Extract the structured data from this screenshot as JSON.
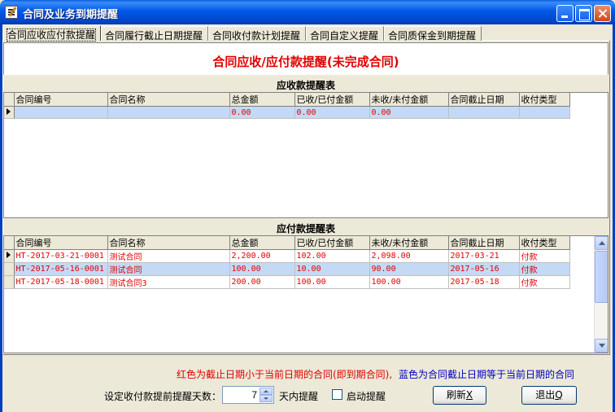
{
  "window": {
    "title": "合同及业务到期提醒"
  },
  "tabs": [
    {
      "label": "合同应收应付款提醒",
      "active": true
    },
    {
      "label": "合同履行截止日期提醒",
      "active": false
    },
    {
      "label": "合同收付款计划提醒",
      "active": false
    },
    {
      "label": "合同自定义提醒",
      "active": false
    },
    {
      "label": "合同质保金到期提醒",
      "active": false
    }
  ],
  "heading": "合同应收/应付款提醒(未完成合同)",
  "receivable": {
    "title": "应收款提醒表",
    "columns": [
      "合同编号",
      "合同名称",
      "总金额",
      "已收/已付金额",
      "未收/未付金额",
      "合同截止日期",
      "收付类型"
    ],
    "rows": [
      {
        "code": "",
        "name": "",
        "total": "0.00",
        "paid": "0.00",
        "unpaid": "0.00",
        "due": "",
        "type": ""
      }
    ]
  },
  "payable": {
    "title": "应付款提醒表",
    "columns": [
      "合同编号",
      "合同名称",
      "总金额",
      "已收/已付金额",
      "未收/未付金额",
      "合同截止日期",
      "收付类型"
    ],
    "rows": [
      {
        "code": "HT-2017-03-21-0001",
        "name": "测试合同",
        "total": "2,200.00",
        "paid": "102.00",
        "unpaid": "2,098.00",
        "due": "2017-03-21",
        "type": "付款"
      },
      {
        "code": "HT-2017-05-16-0001",
        "name": "测试合同",
        "total": "100.00",
        "paid": "10.00",
        "unpaid": "90.00",
        "due": "2017-05-16",
        "type": "付款"
      },
      {
        "code": "HT-2017-05-18-0001",
        "name": "测试合同3",
        "total": "200.00",
        "paid": "100.00",
        "unpaid": "100.00",
        "due": "2017-05-18",
        "type": "付款"
      }
    ]
  },
  "legend": {
    "red": "红色为截止日期小于当前日期的合同(即到期合同),",
    "blue": "蓝色为合同截止日期等于当前日期的合同"
  },
  "footer": {
    "days_label": "设定收付款提前提醒天数：",
    "days_value": "7",
    "days_suffix": "天内提醒",
    "enable_label": "启动提醒",
    "refresh_label": "刷新",
    "refresh_key": "X",
    "exit_label": "退出",
    "exit_key": "Q"
  },
  "colors": {
    "title_bar": "#0058E6",
    "heading": "#E00000",
    "overdue": "#E00000",
    "due_today": "#0000C0",
    "selected_row": "#C4D9F5"
  }
}
